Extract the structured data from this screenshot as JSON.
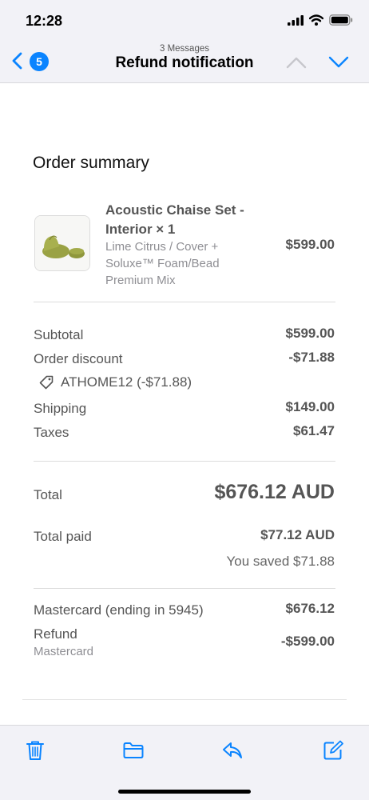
{
  "status_bar": {
    "time": "12:28",
    "icons": [
      "cellular-signal-icon",
      "wifi-icon",
      "battery-icon"
    ]
  },
  "nav": {
    "back_count": "5",
    "message_count": "3 Messages",
    "title": "Refund notification",
    "icons": [
      "back-chevron-icon",
      "previous-message-icon",
      "next-message-icon"
    ],
    "accent_color": "#0a84ff"
  },
  "order": {
    "heading": "Order summary",
    "product": {
      "name": "Acoustic Chaise Set - Interior × 1",
      "variant": "Lime Citrus / Cover + Soluxe™ Foam/Bead Premium Mix",
      "price": "$599.00"
    },
    "lines": {
      "subtotal_label": "Subtotal",
      "subtotal_value": "$599.00",
      "discount_label": "Order discount",
      "discount_value": "-$71.88",
      "discount_code": "ATHOME12 (-$71.88)",
      "shipping_label": "Shipping",
      "shipping_value": "$149.00",
      "taxes_label": "Taxes",
      "taxes_value": "$61.47"
    },
    "totals": {
      "total_label": "Total",
      "total_value": "$676.12 AUD",
      "paid_label": "Total paid",
      "paid_value": "$77.12 AUD",
      "saved_text": "You saved $71.88"
    },
    "payments": {
      "card_label": "Mastercard (ending in 5945)",
      "card_value": "$676.12",
      "refund_label": "Refund",
      "refund_method": "Mastercard",
      "refund_value": "-$599.00"
    }
  },
  "toolbar": {
    "icons": [
      "trash-icon",
      "folder-icon",
      "reply-icon",
      "compose-icon"
    ]
  }
}
